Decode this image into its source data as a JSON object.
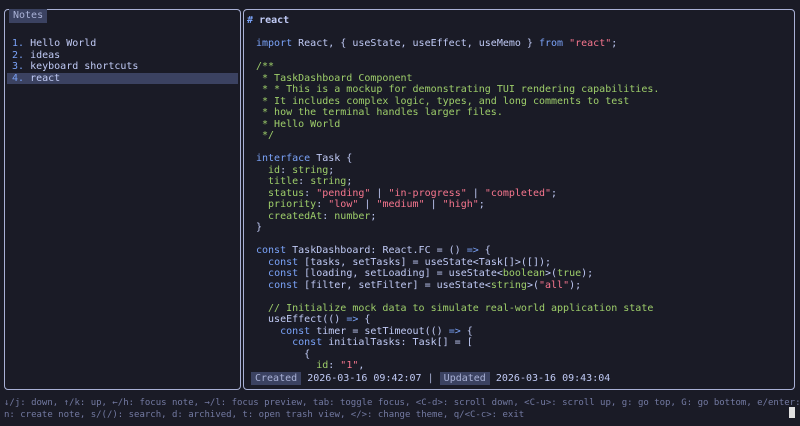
{
  "notes_panel": {
    "title": "Notes",
    "items": [
      {
        "num": "1.",
        "label": "Hello World"
      },
      {
        "num": "2.",
        "label": "ideas"
      },
      {
        "num": "3.",
        "label": "keyboard shortcuts"
      },
      {
        "num": "4.",
        "label": "react"
      }
    ],
    "selected_index": 3
  },
  "preview": {
    "hash": "#",
    "title": "react",
    "code_lines": [
      [
        {
          "t": "import",
          "c": "kw"
        },
        {
          "t": " React, { useState, useEffect, useMemo } ",
          "c": ""
        },
        {
          "t": "from",
          "c": "kw"
        },
        {
          "t": " ",
          "c": ""
        },
        {
          "t": "\"react\"",
          "c": "str"
        },
        {
          "t": ";",
          "c": ""
        }
      ],
      [],
      [
        {
          "t": "/**",
          "c": "cm"
        }
      ],
      [
        {
          "t": " * TaskDashboard Component",
          "c": "cm"
        }
      ],
      [
        {
          "t": " * * This is a mockup for demonstrating TUI rendering capabilities.",
          "c": "cm"
        }
      ],
      [
        {
          "t": " * It includes complex logic, types, and long comments to test",
          "c": "cm"
        }
      ],
      [
        {
          "t": " * how the terminal handles larger files.",
          "c": "cm"
        }
      ],
      [
        {
          "t": " * Hello World",
          "c": "cm"
        }
      ],
      [
        {
          "t": " */",
          "c": "cm"
        }
      ],
      [],
      [
        {
          "t": "interface",
          "c": "kw"
        },
        {
          "t": " Task {",
          "c": ""
        }
      ],
      [
        {
          "t": "  id",
          "c": "str-g"
        },
        {
          "t": ": ",
          "c": ""
        },
        {
          "t": "string",
          "c": "str-g"
        },
        {
          "t": ";",
          "c": ""
        }
      ],
      [
        {
          "t": "  title",
          "c": "str-g"
        },
        {
          "t": ": ",
          "c": ""
        },
        {
          "t": "string",
          "c": "str-g"
        },
        {
          "t": ";",
          "c": ""
        }
      ],
      [
        {
          "t": "  status",
          "c": "str-g"
        },
        {
          "t": ": ",
          "c": ""
        },
        {
          "t": "\"pending\"",
          "c": "str"
        },
        {
          "t": " | ",
          "c": ""
        },
        {
          "t": "\"in-progress\"",
          "c": "str"
        },
        {
          "t": " | ",
          "c": ""
        },
        {
          "t": "\"completed\"",
          "c": "str"
        },
        {
          "t": ";",
          "c": ""
        }
      ],
      [
        {
          "t": "  priority",
          "c": "str-g"
        },
        {
          "t": ": ",
          "c": ""
        },
        {
          "t": "\"low\"",
          "c": "str"
        },
        {
          "t": " | ",
          "c": ""
        },
        {
          "t": "\"medium\"",
          "c": "str"
        },
        {
          "t": " | ",
          "c": ""
        },
        {
          "t": "\"high\"",
          "c": "str"
        },
        {
          "t": ";",
          "c": ""
        }
      ],
      [
        {
          "t": "  createdAt",
          "c": "str-g"
        },
        {
          "t": ": ",
          "c": ""
        },
        {
          "t": "number",
          "c": "str-g"
        },
        {
          "t": ";",
          "c": ""
        }
      ],
      [
        {
          "t": "}",
          "c": ""
        }
      ],
      [],
      [
        {
          "t": "const",
          "c": "kw"
        },
        {
          "t": " TaskDashboard: React.FC = () ",
          "c": ""
        },
        {
          "t": "=>",
          "c": "kw"
        },
        {
          "t": " {",
          "c": ""
        }
      ],
      [
        {
          "t": "  ",
          "c": ""
        },
        {
          "t": "const",
          "c": "kw"
        },
        {
          "t": " [tasks, setTasks] = useState<Task[]>([]);",
          "c": ""
        }
      ],
      [
        {
          "t": "  ",
          "c": ""
        },
        {
          "t": "const",
          "c": "kw"
        },
        {
          "t": " [loading, setLoading] = useState<",
          "c": ""
        },
        {
          "t": "boolean",
          "c": "str-g"
        },
        {
          "t": ">(",
          "c": ""
        },
        {
          "t": "true",
          "c": "str-g"
        },
        {
          "t": ");",
          "c": ""
        }
      ],
      [
        {
          "t": "  ",
          "c": ""
        },
        {
          "t": "const",
          "c": "kw"
        },
        {
          "t": " [filter, setFilter] = useState<",
          "c": ""
        },
        {
          "t": "string",
          "c": "str-g"
        },
        {
          "t": ">(",
          "c": ""
        },
        {
          "t": "\"all\"",
          "c": "str"
        },
        {
          "t": ");",
          "c": ""
        }
      ],
      [],
      [
        {
          "t": "  // Initialize mock data to simulate real-world application state",
          "c": "cm"
        }
      ],
      [
        {
          "t": "  useEffect(() ",
          "c": ""
        },
        {
          "t": "=>",
          "c": "kw"
        },
        {
          "t": " {",
          "c": ""
        }
      ],
      [
        {
          "t": "    ",
          "c": ""
        },
        {
          "t": "const",
          "c": "kw"
        },
        {
          "t": " timer = setTimeout(() ",
          "c": ""
        },
        {
          "t": "=>",
          "c": "kw"
        },
        {
          "t": " {",
          "c": ""
        }
      ],
      [
        {
          "t": "      ",
          "c": ""
        },
        {
          "t": "const",
          "c": "kw"
        },
        {
          "t": " initialTasks: Task[] = [",
          "c": ""
        }
      ],
      [
        {
          "t": "        {",
          "c": ""
        }
      ],
      [
        {
          "t": "          id",
          "c": "str-g"
        },
        {
          "t": ": ",
          "c": ""
        },
        {
          "t": "\"1\"",
          "c": "str"
        },
        {
          "t": ",",
          "c": ""
        }
      ]
    ],
    "created_label": "Created",
    "created_value": "2026-03-16 09:42:07",
    "separator": "|",
    "updated_label": "Updated",
    "updated_value": "2026-03-16 09:43:04"
  },
  "help": {
    "line1": "↓/j: down, ↑/k: up, ←/h: focus note, →/l: focus preview, tab: toggle focus, <C-d>: scroll down, <C-u>: scroll up, g: go top, G: go bottom, e/enter: edit,",
    "line2": "n: create note, s/(/): search, d: archived, t: open trash view, </>: change theme, q/<C-c>: exit"
  },
  "colors": {
    "background": "#1a1b26",
    "keyword": "#7aa2f7",
    "string": "#f7768e",
    "comment": "#9ece6a",
    "selection": "#3b4261"
  }
}
